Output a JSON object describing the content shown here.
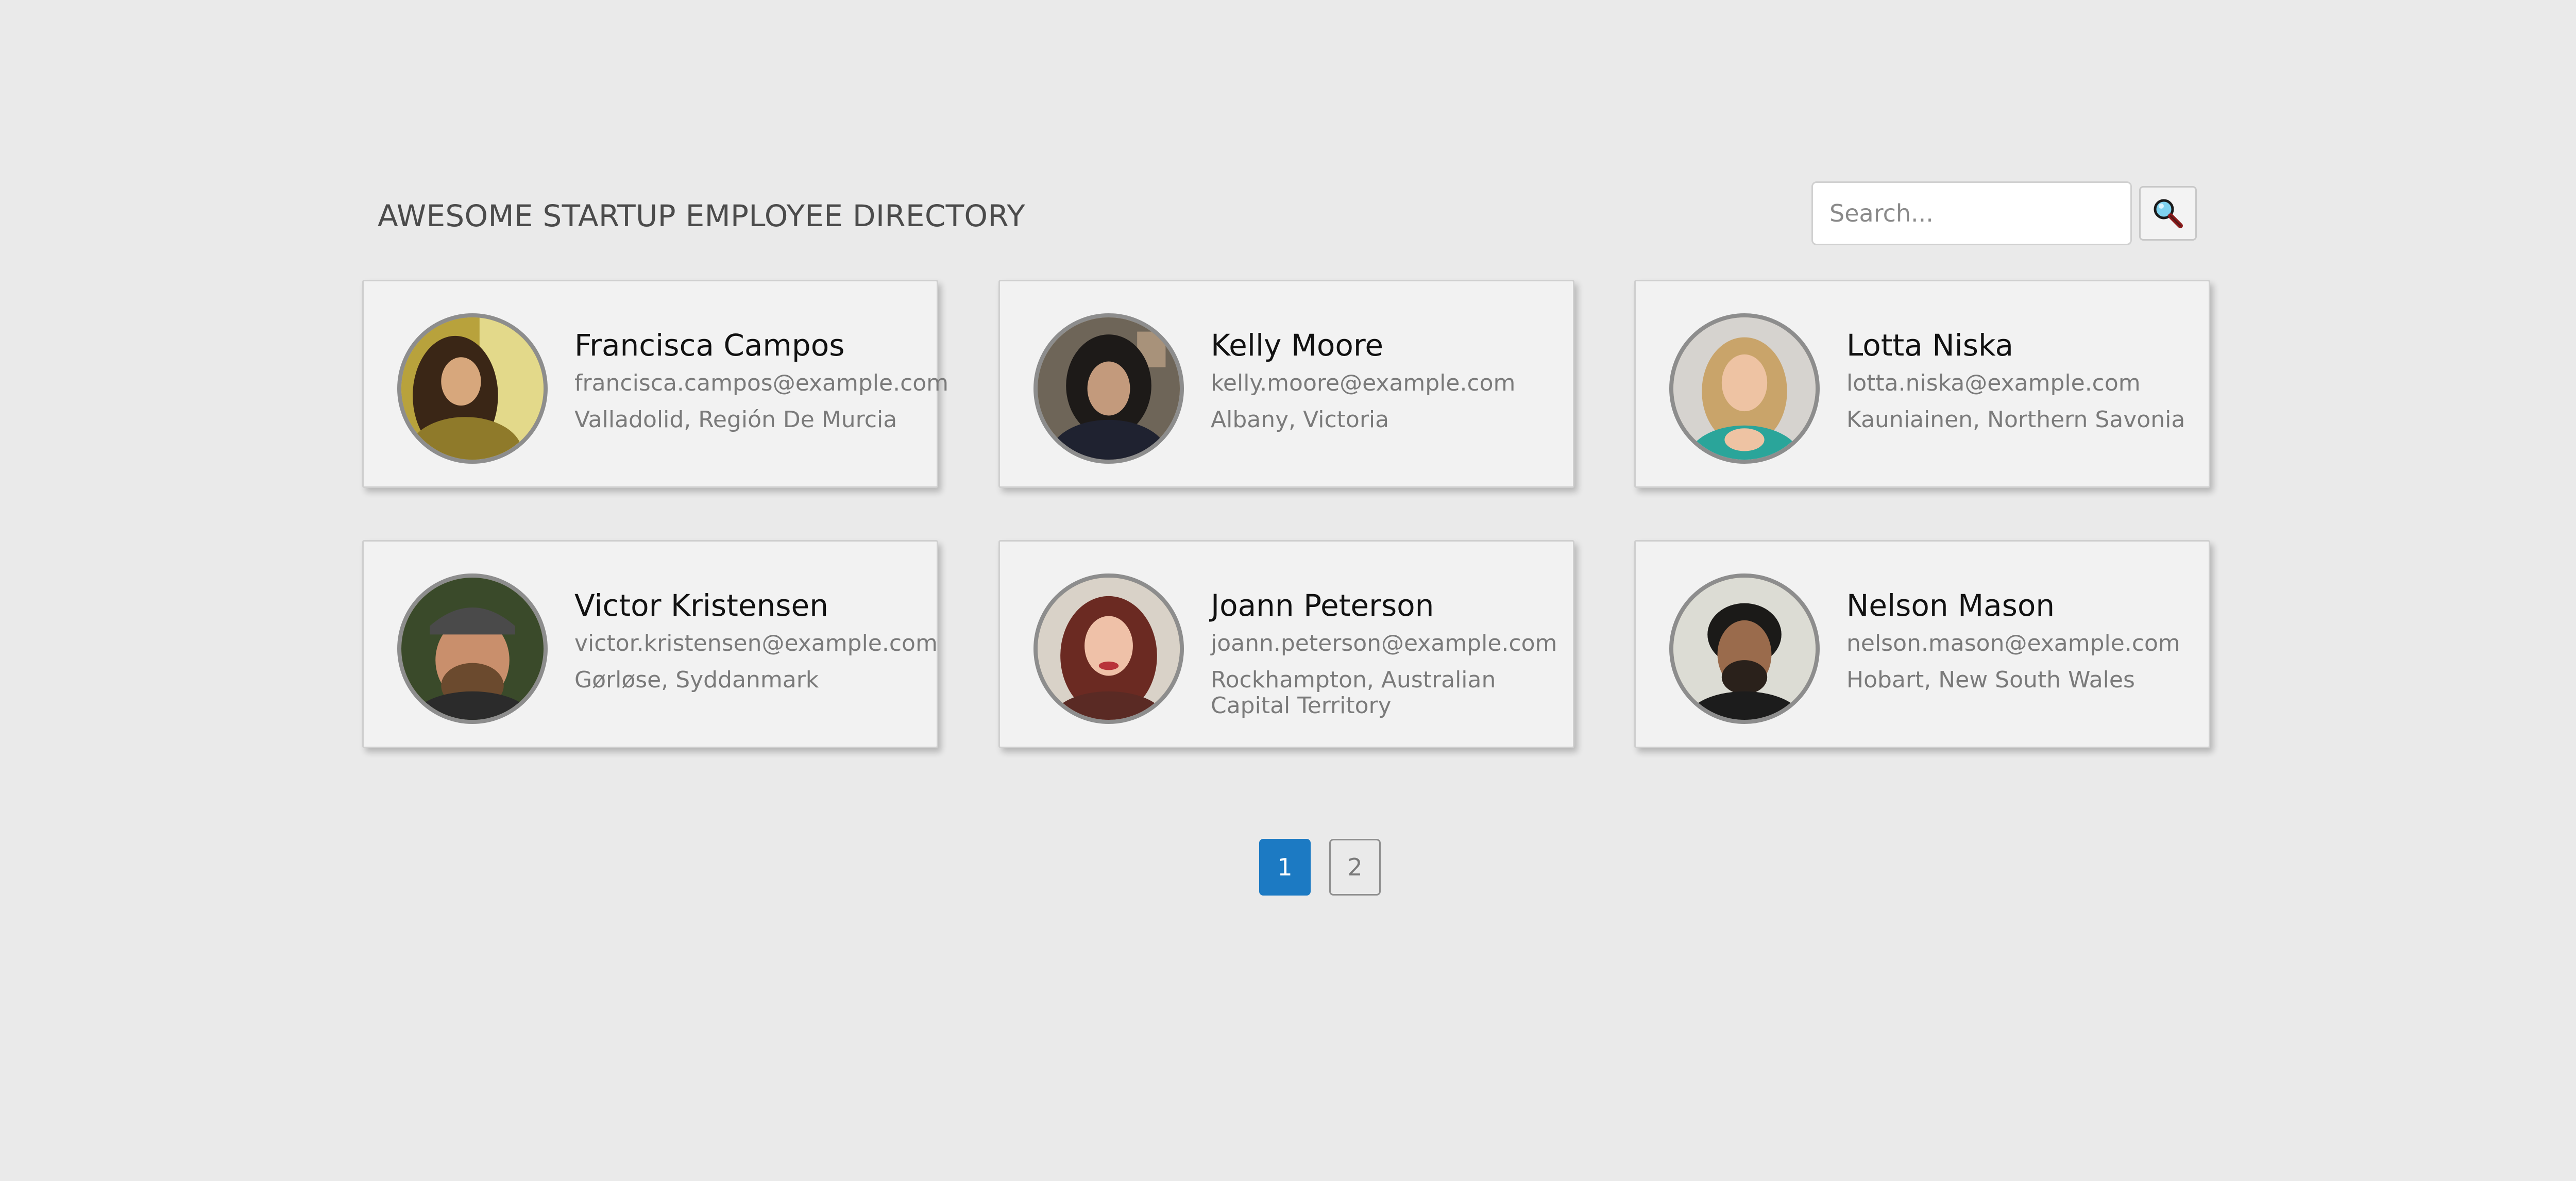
{
  "header": {
    "title": "AWESOME STARTUP EMPLOYEE DIRECTORY"
  },
  "search": {
    "placeholder": "Search...",
    "value": "",
    "button_icon": "magnifying-glass-icon"
  },
  "employees": [
    {
      "name": "Francisca Campos",
      "email": "francisca.campos@example.com",
      "location": "Valladolid, Región De Murcia"
    },
    {
      "name": "Kelly Moore",
      "email": "kelly.moore@example.com",
      "location": "Albany, Victoria"
    },
    {
      "name": "Lotta Niska",
      "email": "lotta.niska@example.com",
      "location": "Kauniainen, Northern Savonia"
    },
    {
      "name": "Victor Kristensen",
      "email": "victor.kristensen@example.com",
      "location": "Gørløse, Syddanmark"
    },
    {
      "name": "Joann Peterson",
      "email": "joann.peterson@example.com",
      "location": "Rockhampton, Australian Capital Territory"
    },
    {
      "name": "Nelson Mason",
      "email": "nelson.mason@example.com",
      "location": "Hobart, New South Wales"
    }
  ],
  "pagination": {
    "pages": [
      "1",
      "2"
    ],
    "current": "1"
  },
  "colors": {
    "background": "#eaeaea",
    "card": "#f2f2f2",
    "accent": "#1c7ac3"
  }
}
